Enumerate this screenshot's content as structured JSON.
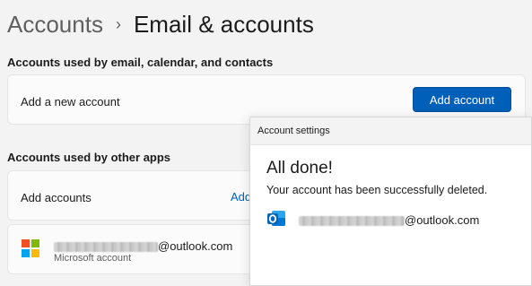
{
  "breadcrumb": {
    "parent": "Accounts",
    "separator": "›",
    "current": "Email & accounts"
  },
  "email_section": {
    "title": "Accounts used by email, calendar, and contacts",
    "row_label": "Add a new account",
    "button_label": "Add account"
  },
  "other_section": {
    "title": "Accounts used by other apps",
    "row_label": "Add accounts",
    "row_link_partial": "Add",
    "account": {
      "email_suffix": "@outlook.com",
      "type": "Microsoft account"
    }
  },
  "popup": {
    "title": "Account settings",
    "heading": "All done!",
    "message": "Your account has been successfully deleted.",
    "email_suffix": "@outlook.com"
  },
  "colors": {
    "accent": "#005fb8",
    "ms_red": "#f25022",
    "ms_green": "#7fba00",
    "ms_blue": "#00a4ef",
    "ms_yellow": "#ffb900",
    "outlook_blue": "#0364b8"
  }
}
